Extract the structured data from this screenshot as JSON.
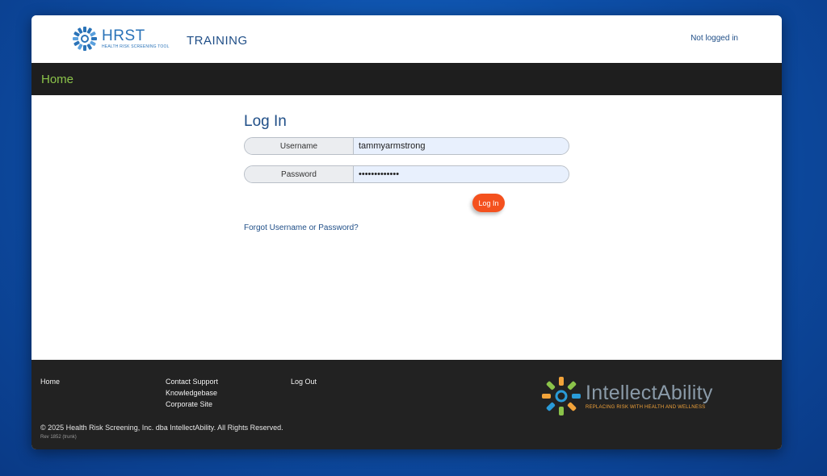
{
  "header": {
    "logo_name": "HRST",
    "logo_subtitle": "HEALTH RISK SCREENING TOOL",
    "environment": "TRAINING",
    "login_status": "Not logged in"
  },
  "nav": {
    "home_label": "Home"
  },
  "login": {
    "title": "Log In",
    "username_label": "Username",
    "username_value": "tammyarmstrong",
    "password_label": "Password",
    "password_value": "•••••••••••••",
    "submit_label": "Log In",
    "forgot_label": "Forgot Username or Password?"
  },
  "footer": {
    "links_col1": [
      "Home"
    ],
    "links_col2": [
      "Contact Support",
      "Knowledgebase",
      "Corporate Site"
    ],
    "links_col3": [
      "Log Out"
    ],
    "copyright": "© 2025 Health Risk Screening, Inc. dba IntellectAbility. All Rights Reserved.",
    "revision": "Rev 1852 (trunk)",
    "partner_name": "IntellectAbility",
    "partner_tagline": "REPLACING RISK WITH HEALTH AND WELLNESS"
  },
  "colors": {
    "accent_blue": "#1f4e87",
    "nav_green": "#8bc34a",
    "button_orange": "#f4511e",
    "footer_bg": "#222222"
  }
}
